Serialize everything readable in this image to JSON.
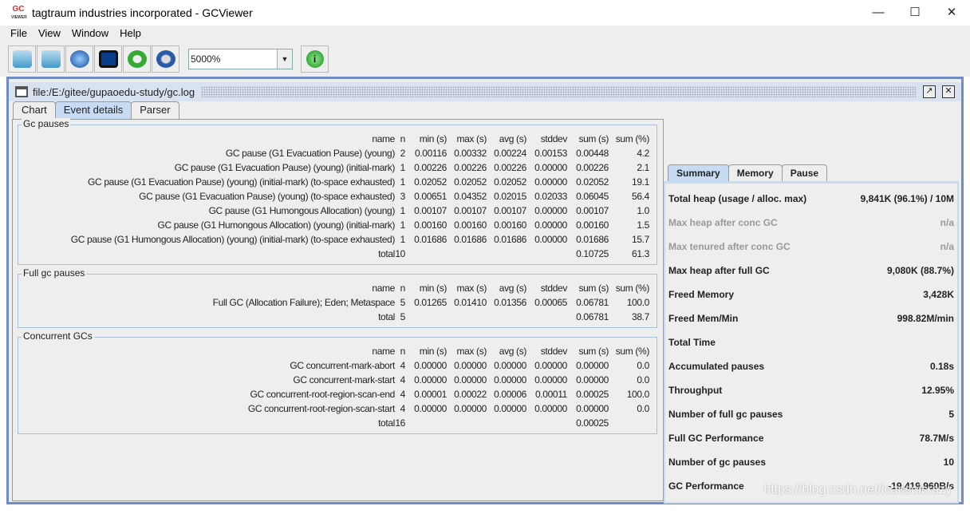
{
  "window": {
    "title": "tagtraum industries incorporated - GCViewer",
    "logo": "GC VIEWER",
    "controls": [
      "minimize-icon",
      "maximize-icon",
      "close-icon"
    ]
  },
  "menu": [
    {
      "label": "File"
    },
    {
      "label": "View"
    },
    {
      "label": "Window"
    },
    {
      "label": "Help"
    }
  ],
  "toolbar": {
    "buttons": [
      "open-file-icon",
      "open-recent-icon",
      "open-url-icon",
      "save-icon",
      "refresh-icon",
      "watch-icon"
    ],
    "zoom": "5000%",
    "info": "info-icon"
  },
  "frame": {
    "title": "file:/E:/gitee/gupaoedu-study/gc.log"
  },
  "tabs": [
    {
      "label": "Chart"
    },
    {
      "label": "Event details"
    },
    {
      "label": "Parser"
    }
  ],
  "columns": [
    "name",
    "n",
    "min (s)",
    "max (s)",
    "avg (s)",
    "stddev",
    "sum (s)",
    "sum (%)"
  ],
  "groups": [
    {
      "label": "Gc pauses",
      "rows": [
        [
          "GC pause (G1 Evacuation Pause) (young)",
          "2",
          "0.00116",
          "0.00332",
          "0.00224",
          "0.00153",
          "0.00448",
          "4.2"
        ],
        [
          "GC pause (G1 Evacuation Pause) (young) (initial-mark)",
          "1",
          "0.00226",
          "0.00226",
          "0.00226",
          "0.00000",
          "0.00226",
          "2.1"
        ],
        [
          "GC pause (G1 Evacuation Pause) (young) (initial-mark) (to-space exhausted)",
          "1",
          "0.02052",
          "0.02052",
          "0.02052",
          "0.00000",
          "0.02052",
          "19.1"
        ],
        [
          "GC pause (G1 Evacuation Pause) (young) (to-space exhausted)",
          "3",
          "0.00651",
          "0.04352",
          "0.02015",
          "0.02033",
          "0.06045",
          "56.4"
        ],
        [
          "GC pause (G1 Humongous Allocation) (young)",
          "1",
          "0.00107",
          "0.00107",
          "0.00107",
          "0.00000",
          "0.00107",
          "1.0"
        ],
        [
          "GC pause (G1 Humongous Allocation) (young) (initial-mark)",
          "1",
          "0.00160",
          "0.00160",
          "0.00160",
          "0.00000",
          "0.00160",
          "1.5"
        ],
        [
          "GC pause (G1 Humongous Allocation) (young) (initial-mark) (to-space exhausted)",
          "1",
          "0.01686",
          "0.01686",
          "0.01686",
          "0.00000",
          "0.01686",
          "15.7"
        ],
        [
          "total",
          "10",
          "",
          "",
          "",
          "",
          "0.10725",
          "61.3"
        ]
      ]
    },
    {
      "label": "Full gc pauses",
      "rows": [
        [
          "Full GC (Allocation Failure); Eden; Metaspace",
          "5",
          "0.01265",
          "0.01410",
          "0.01356",
          "0.00065",
          "0.06781",
          "100.0"
        ],
        [
          "total",
          "5",
          "",
          "",
          "",
          "",
          "0.06781",
          "38.7"
        ]
      ]
    },
    {
      "label": "Concurrent GCs",
      "rows": [
        [
          "GC concurrent-mark-abort",
          "4",
          "0.00000",
          "0.00000",
          "0.00000",
          "0.00000",
          "0.00000",
          "0.0"
        ],
        [
          "GC concurrent-mark-start",
          "4",
          "0.00000",
          "0.00000",
          "0.00000",
          "0.00000",
          "0.00000",
          "0.0"
        ],
        [
          "GC concurrent-root-region-scan-end",
          "4",
          "0.00001",
          "0.00022",
          "0.00006",
          "0.00011",
          "0.00025",
          "100.0"
        ],
        [
          "GC concurrent-root-region-scan-start",
          "4",
          "0.00000",
          "0.00000",
          "0.00000",
          "0.00000",
          "0.00000",
          "0.0"
        ],
        [
          "total",
          "16",
          "",
          "",
          "",
          "",
          "0.00025",
          ""
        ]
      ]
    }
  ],
  "summary_tabs": [
    {
      "label": "Summary"
    },
    {
      "label": "Memory"
    },
    {
      "label": "Pause"
    }
  ],
  "summary": [
    {
      "label": "Total heap (usage / alloc. max)",
      "value": "9,841K (96.1%) / 10M"
    },
    {
      "label": "Max heap after conc GC",
      "value": "n/a",
      "disabled": true
    },
    {
      "label": "Max tenured after conc GC",
      "value": "n/a",
      "disabled": true
    },
    {
      "label": "Max heap after full GC",
      "value": "9,080K (88.7%)"
    },
    {
      "label": "Freed Memory",
      "value": "3,428K"
    },
    {
      "label": "Freed Mem/Min",
      "value": "998.82M/min"
    },
    {
      "label": "Total Time",
      "value": ""
    },
    {
      "label": "Accumulated pauses",
      "value": "0.18s"
    },
    {
      "label": "Throughput",
      "value": "12.95%"
    },
    {
      "label": "Number of full gc pauses",
      "value": "5"
    },
    {
      "label": "Full GC Performance",
      "value": "78.7M/s"
    },
    {
      "label": "Number of gc pauses",
      "value": "10"
    },
    {
      "label": "GC Performance",
      "value": "-19,419,960B/s"
    }
  ],
  "watermark": "https://blog.csdn.net/icansoicrazy"
}
